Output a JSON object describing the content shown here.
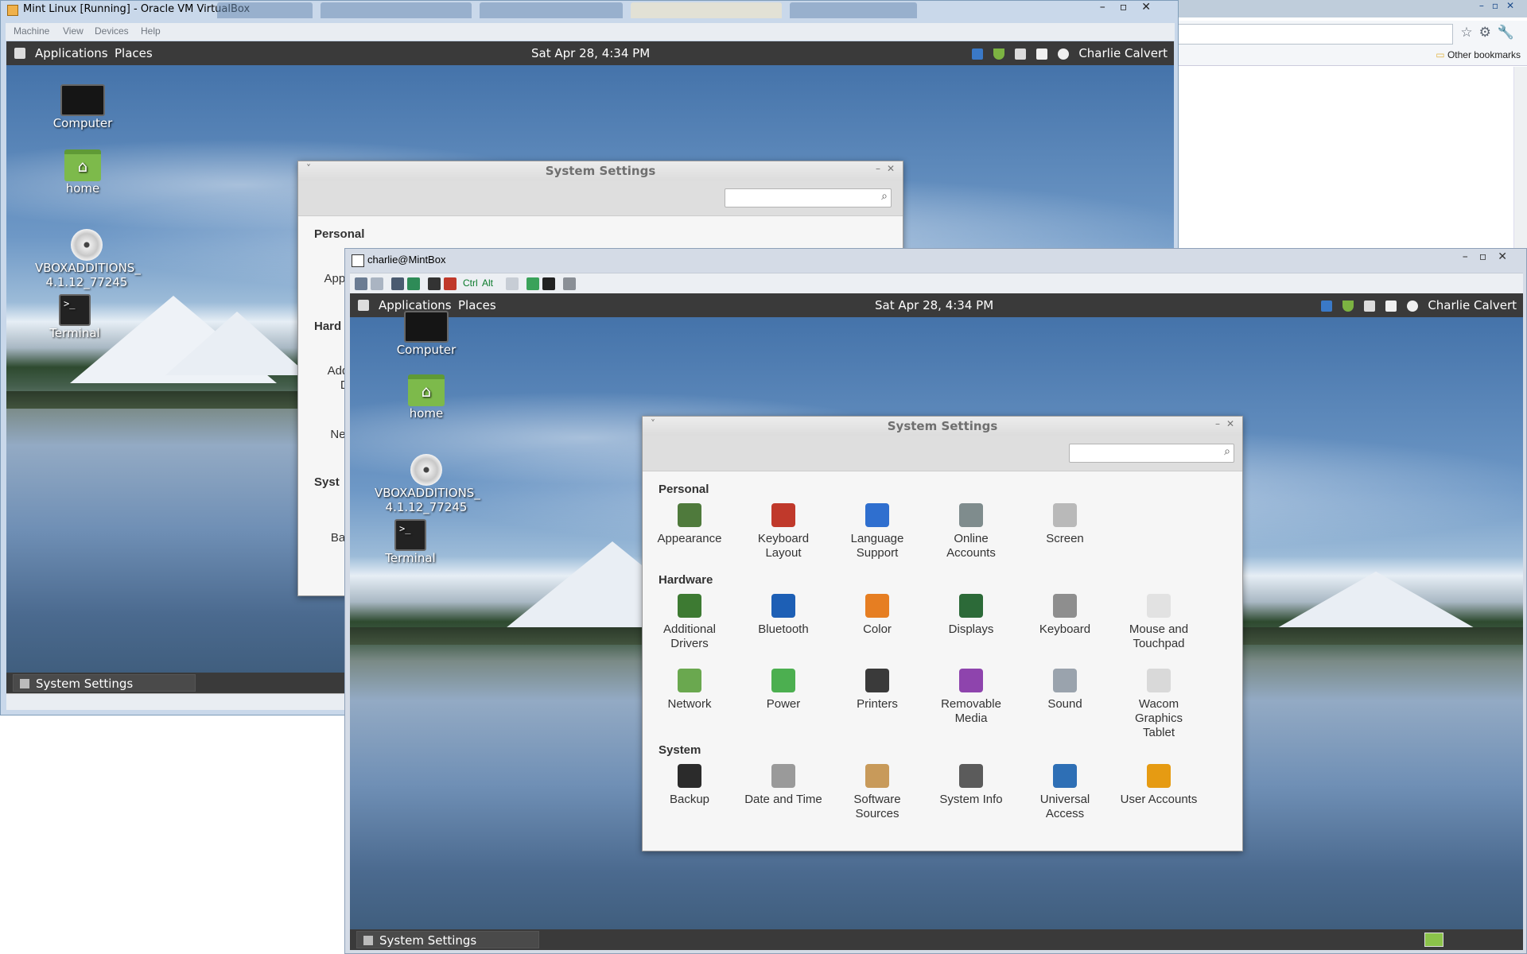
{
  "host": {
    "browser": {
      "bookmarks_label": "Other bookmarks"
    }
  },
  "vbox": {
    "title": "Mint Linux [Running] - Oracle VM VirtualBox",
    "menu": [
      "Machine",
      "View",
      "Devices",
      "Help"
    ]
  },
  "panel": {
    "applications": "Applications",
    "places": "Places",
    "clock": "Sat Apr 28,  4:34 PM",
    "user": "Charlie Calvert"
  },
  "desktop": {
    "icons": [
      "Computer",
      "home",
      "VBOXADDITIONS_\n4.1.12_77245",
      "Terminal"
    ]
  },
  "taskbar": {
    "item": "System Settings"
  },
  "rdp": {
    "title": "charlie@MintBox",
    "toolbar_text": [
      "Ctrl",
      "Alt"
    ]
  },
  "settings": {
    "title": "System Settings",
    "search_placeholder": "",
    "sections": [
      {
        "name": "Personal",
        "items": [
          {
            "label": "Appearance",
            "icon": "appearance-icon",
            "color": "#4f7a3c"
          },
          {
            "label": "Keyboard Layout",
            "icon": "keyboard-layout-icon",
            "color": "#c0392b"
          },
          {
            "label": "Language Support",
            "icon": "language-support-icon",
            "color": "#2f6fcf"
          },
          {
            "label": "Online Accounts",
            "icon": "online-accounts-icon",
            "color": "#7f8c8d"
          },
          {
            "label": "Screen",
            "icon": "screen-lock-icon",
            "color": "#b9b9b9"
          }
        ]
      },
      {
        "name": "Hardware",
        "items": [
          {
            "label": "Additional Drivers",
            "icon": "additional-drivers-icon",
            "color": "#3d7a32"
          },
          {
            "label": "Bluetooth",
            "icon": "bluetooth-icon",
            "color": "#1d5fb5"
          },
          {
            "label": "Color",
            "icon": "color-icon",
            "color": "#e67e22"
          },
          {
            "label": "Displays",
            "icon": "displays-icon",
            "color": "#2c6a38"
          },
          {
            "label": "Keyboard",
            "icon": "keyboard-icon",
            "color": "#8e8e8e"
          },
          {
            "label": "Mouse and Touchpad",
            "icon": "mouse-icon",
            "color": "#e2e2e2"
          },
          {
            "label": "Network",
            "icon": "network-icon",
            "color": "#6aa84f"
          },
          {
            "label": "Power",
            "icon": "power-icon",
            "color": "#4caf50"
          },
          {
            "label": "Printers",
            "icon": "printers-icon",
            "color": "#3a3a3a"
          },
          {
            "label": "Removable Media",
            "icon": "removable-media-icon",
            "color": "#8e44ad"
          },
          {
            "label": "Sound",
            "icon": "sound-icon",
            "color": "#9aa3ad"
          },
          {
            "label": "Wacom Graphics Tablet",
            "icon": "wacom-tablet-icon",
            "color": "#d9d9d9"
          }
        ]
      },
      {
        "name": "System",
        "items": [
          {
            "label": "Backup",
            "icon": "backup-icon",
            "color": "#2b2b2b"
          },
          {
            "label": "Date and Time",
            "icon": "clock-icon",
            "color": "#9a9a9a"
          },
          {
            "label": "Software Sources",
            "icon": "software-sources-icon",
            "color": "#c89a5a"
          },
          {
            "label": "System Info",
            "icon": "system-info-icon",
            "color": "#5b5b5b"
          },
          {
            "label": "Universal Access",
            "icon": "universal-access-icon",
            "color": "#2e6fb5"
          },
          {
            "label": "User Accounts",
            "icon": "user-accounts-icon",
            "color": "#e69b12"
          }
        ]
      }
    ],
    "partial_labels": [
      "Appe",
      "Hard",
      "Add",
      "Di",
      "Ne",
      "Syst",
      "Ba"
    ]
  }
}
